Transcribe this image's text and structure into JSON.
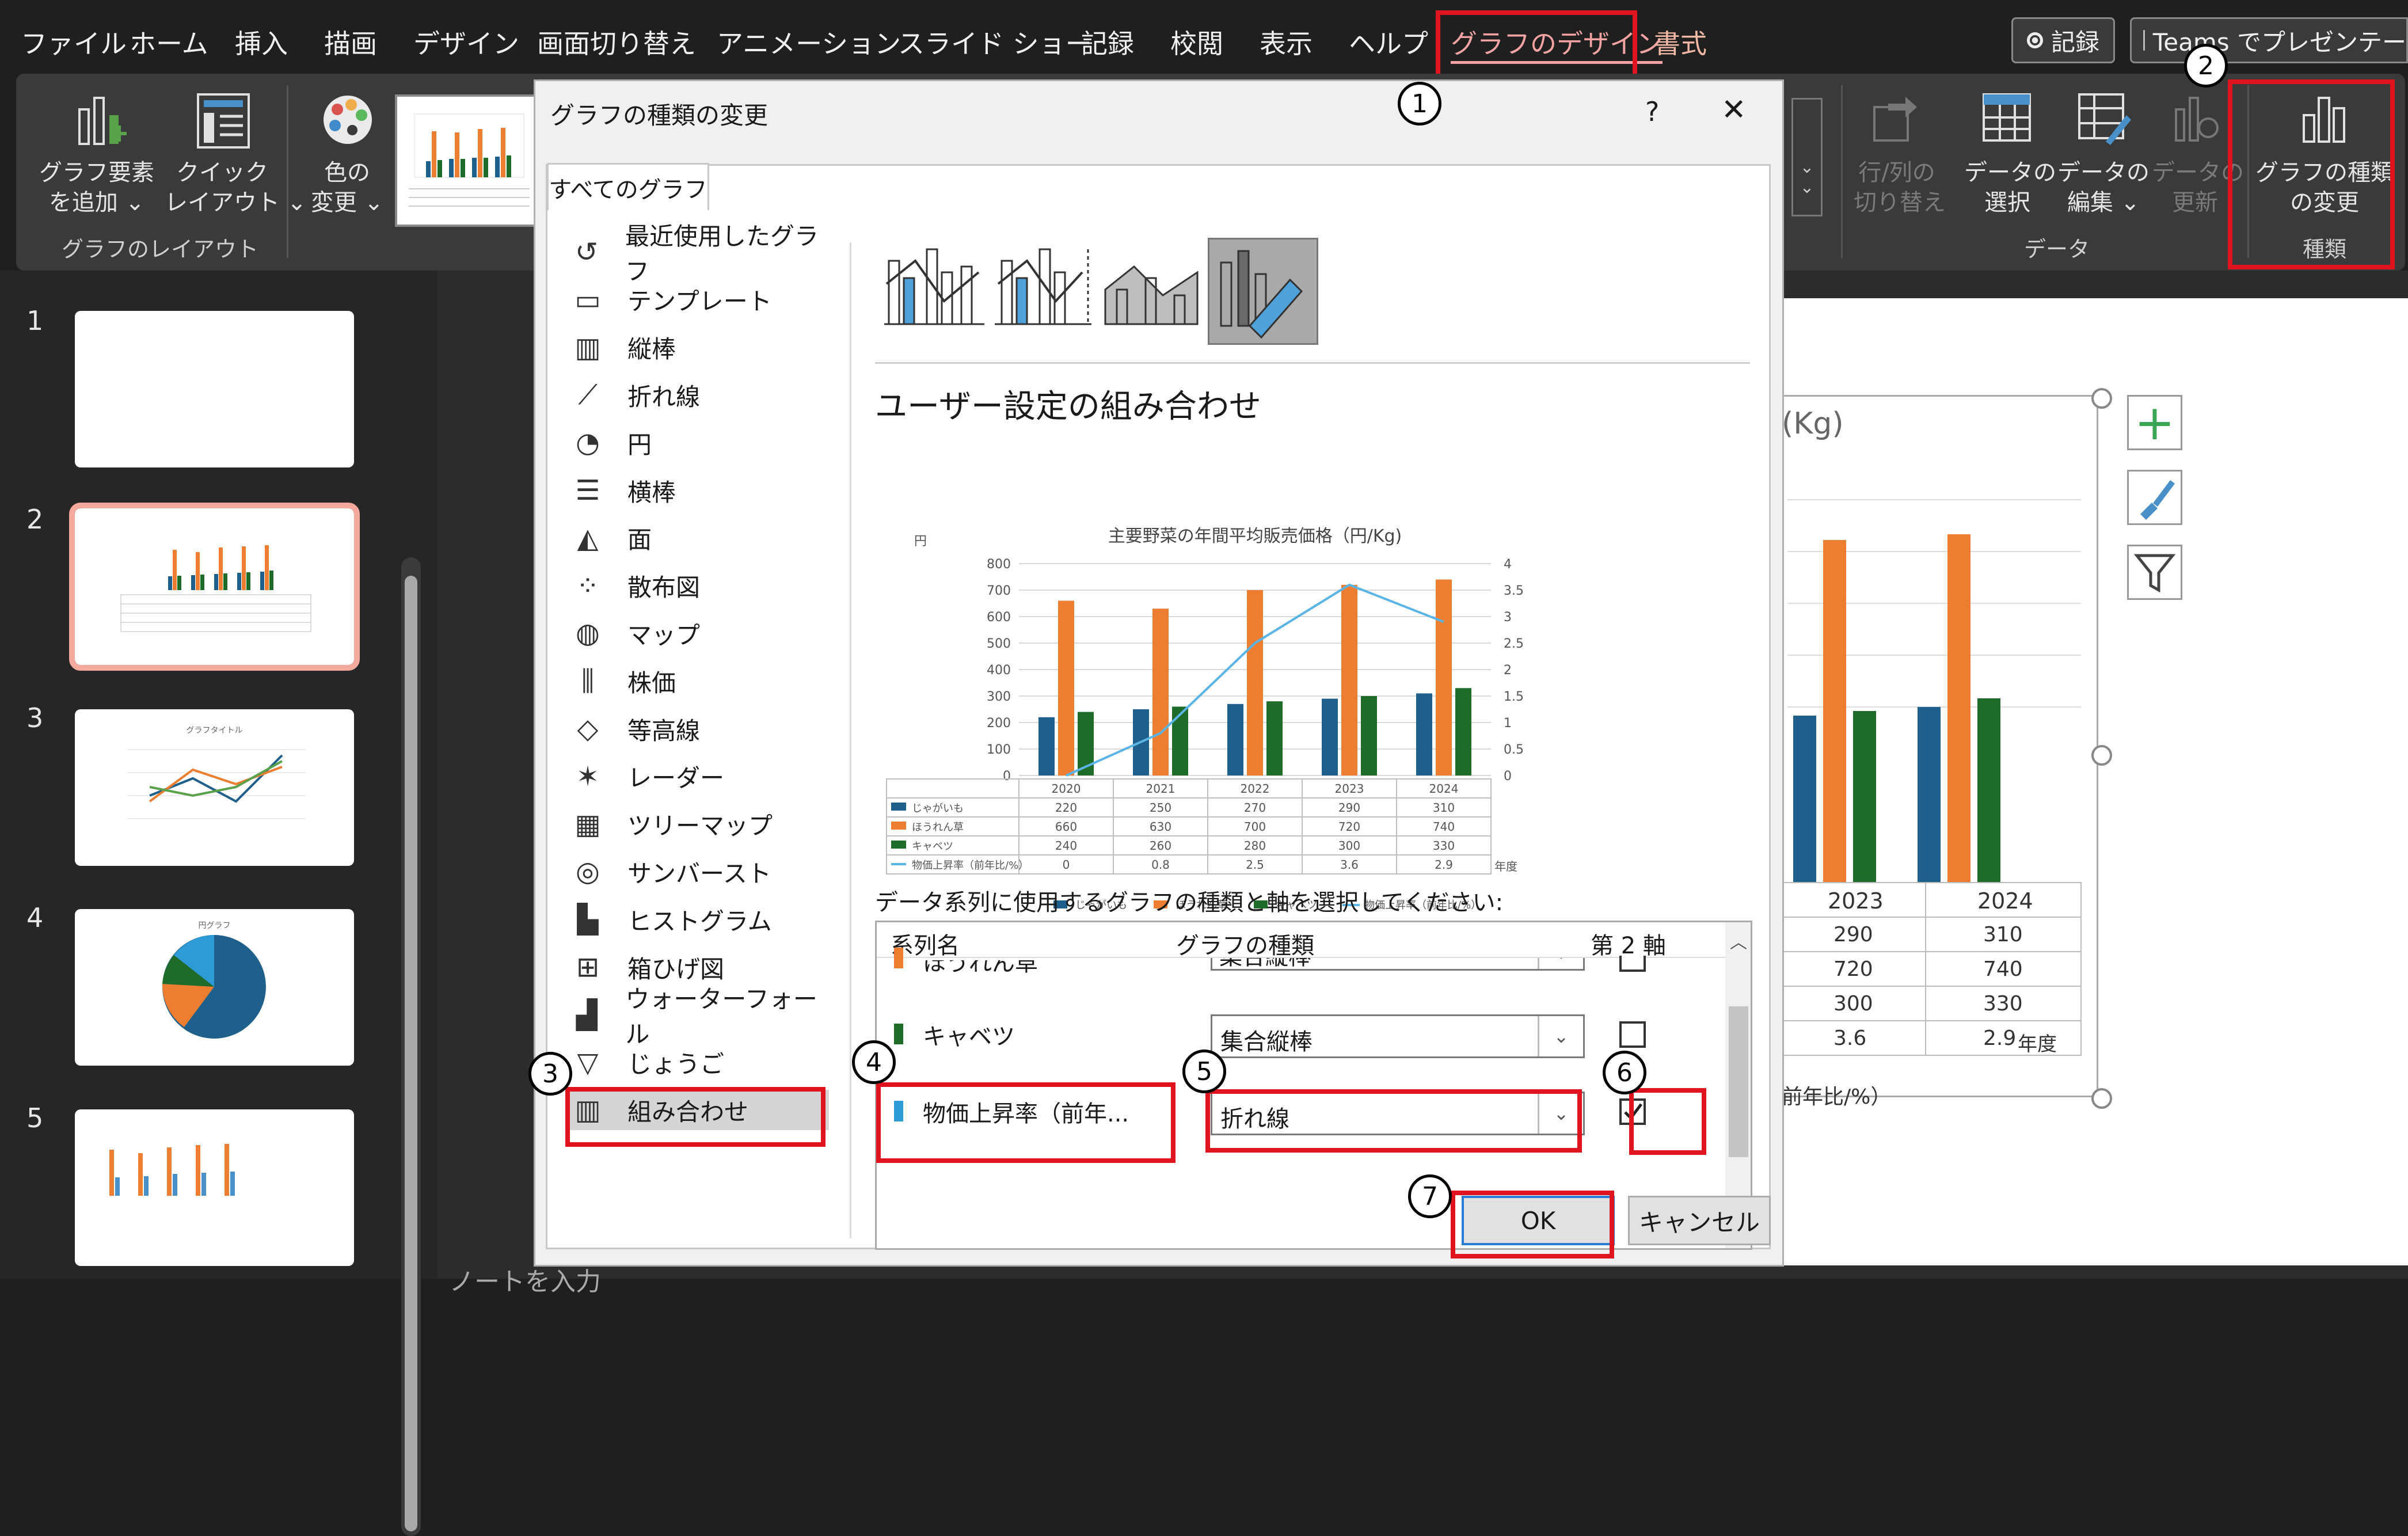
{
  "menu": {
    "items": [
      "ファイル",
      "ホーム",
      "挿入",
      "描画",
      "デザイン",
      "画面切り替え",
      "アニメーション",
      "スライド ショー",
      "記録",
      "校閲",
      "表示",
      "ヘルプ",
      "グラフのデザイン",
      "書式"
    ],
    "record_button": "記録",
    "teams_button": "Teams でプレゼンテー"
  },
  "ribbon": {
    "add_element": "グラフ要素\nを追加 ⌄",
    "quick_layout": "クイック\nレイアウト ⌄",
    "change_color": "色の\n変更 ⌄",
    "layout_group": "グラフのレイアウト",
    "switch_row_col": "行/列の\n切り替え",
    "select_data": "データの\n選択",
    "edit_data": "データの\n編集 ⌄",
    "refresh_data": "データの\n更新",
    "data_group": "データ",
    "change_chart_type": "グラフの種類\nの変更",
    "type_group": "種類"
  },
  "slides": {
    "numbers": [
      "1",
      "2",
      "3",
      "4",
      "5"
    ],
    "thumb3_title": "グラフタイトル",
    "thumb4_title": "円グラフ"
  },
  "dialog": {
    "title": "グラフの種類の変更",
    "help": "?",
    "close": "✕",
    "tab": "すべてのグラフ",
    "nav": [
      "最近使用したグラフ",
      "テンプレート",
      "縦棒",
      "折れ線",
      "円",
      "横棒",
      "面",
      "散布図",
      "マップ",
      "株価",
      "等高線",
      "レーダー",
      "ツリーマップ",
      "サンバースト",
      "ヒストグラム",
      "箱ひげ図",
      "ウォーターフォール",
      "じょうご",
      "組み合わせ"
    ],
    "nav_icons": [
      "↺",
      "▭",
      "▥",
      "⟋",
      "◔",
      "☰",
      "◭",
      "⁘",
      "◍",
      "⫼",
      "◇",
      "✶",
      "▦",
      "◎",
      "▙",
      "⊞",
      "▟",
      "▽",
      "▥"
    ],
    "combo_title": "ユーザー設定の組み合わせ",
    "series_prompt": "データ系列に使用するグラフの種類と軸を選択してください:",
    "col_series": "系列名",
    "col_type": "グラフの種類",
    "col_axis": "第 2 軸",
    "rows": [
      {
        "name": "ほうれん草",
        "type": "集合縦棒",
        "color": "#ed7d31"
      },
      {
        "name": "キャベツ",
        "type": "集合縦棒",
        "color": "#1e6b2a"
      },
      {
        "name": "物価上昇率（前年...",
        "type": "折れ線",
        "color": "#2e9bd6"
      }
    ],
    "ok": "OK",
    "cancel": "キャンセル"
  },
  "chart_data": {
    "type": "bar",
    "title": "主要野菜の年間平均販売価格（円/Kg)",
    "ylabel": "円",
    "categories": [
      "2020",
      "2021",
      "2022",
      "2023",
      "2024"
    ],
    "ylim": [
      0,
      800
    ],
    "y2lim": [
      0,
      4
    ],
    "y_ticks": [
      "0",
      "100",
      "200",
      "300",
      "400",
      "500",
      "600",
      "700",
      "800"
    ],
    "y2_ticks": [
      "0",
      "0.5",
      "1",
      "1.5",
      "2",
      "2.5",
      "3",
      "3.5",
      "4"
    ],
    "series": [
      {
        "name": "じゃがいも",
        "values": [
          220,
          250,
          270,
          290,
          310
        ],
        "color": "#1f5f8b",
        "kind": "bar"
      },
      {
        "name": "ほうれん草",
        "values": [
          660,
          630,
          700,
          720,
          740
        ],
        "color": "#ed7d31",
        "kind": "bar"
      },
      {
        "name": "キャベツ",
        "values": [
          240,
          260,
          280,
          300,
          330
        ],
        "color": "#1e6b2a",
        "kind": "bar"
      },
      {
        "name": "物価上昇率（前年比/%）",
        "values": [
          0,
          0.8,
          2.5,
          3.6,
          2.9
        ],
        "color": "#5ab4e6",
        "kind": "line",
        "axis": "secondary"
      }
    ],
    "table_suffix": "年度",
    "legend_position": "bottom"
  },
  "bg_chart": {
    "title_fragment": "(Kg)",
    "years": [
      "2023",
      "2024"
    ],
    "rows": [
      [
        "290",
        "310"
      ],
      [
        "720",
        "740"
      ],
      [
        "300",
        "330"
      ],
      [
        "3.6",
        "2.9"
      ]
    ],
    "year_label": "年度",
    "legend_fragment": "前年比/%）"
  },
  "callouts": [
    "1",
    "2",
    "3",
    "4",
    "5",
    "6",
    "7"
  ],
  "notes_placeholder": "ノートを入力"
}
